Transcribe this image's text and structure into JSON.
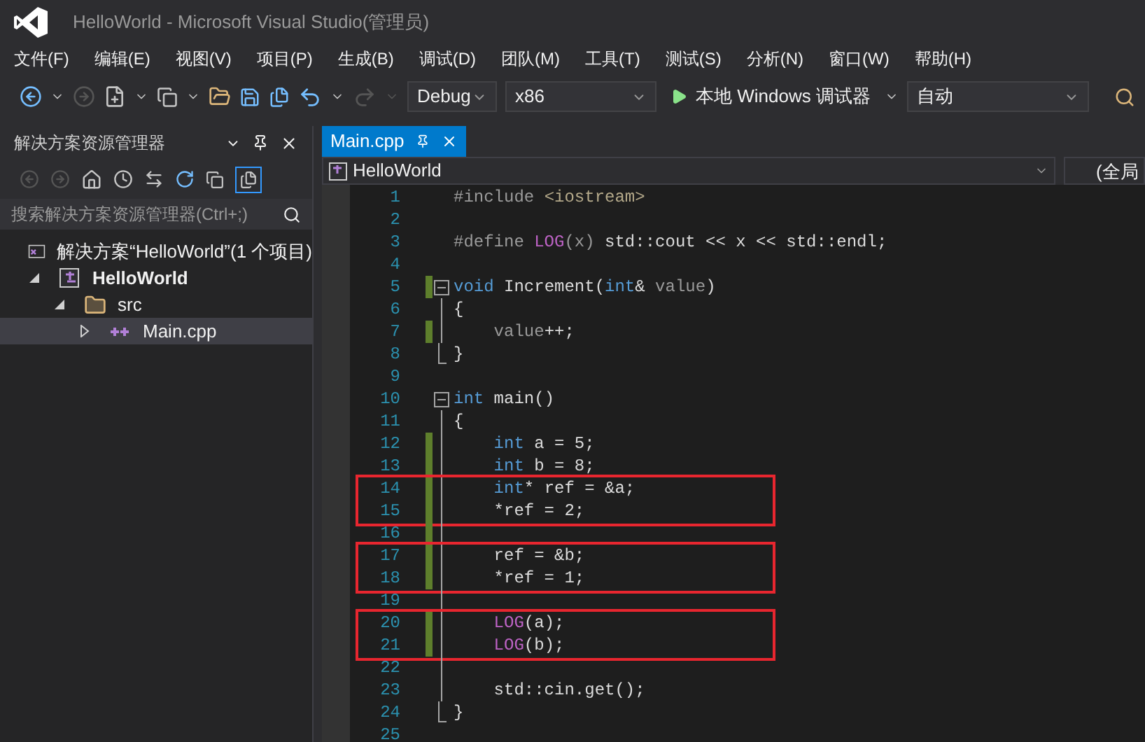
{
  "window": {
    "title": "HelloWorld - Microsoft Visual Studio(管理员)"
  },
  "menu": [
    "文件(F)",
    "编辑(E)",
    "视图(V)",
    "项目(P)",
    "生成(B)",
    "调试(D)",
    "团队(M)",
    "工具(T)",
    "测试(S)",
    "分析(N)",
    "窗口(W)",
    "帮助(H)"
  ],
  "toolbar": {
    "configuration": "Debug",
    "platform": "x86",
    "debugger": "本地 Windows 调试器",
    "target": "自动"
  },
  "solution_explorer": {
    "title": "解决方案资源管理器",
    "search": {
      "placeholder": "搜索解决方案资源管理器(Ctrl+;)"
    },
    "solution": {
      "label": "解决方案“HelloWorld”(1 个项目)"
    },
    "tree": [
      {
        "label": "HelloWorld",
        "kind": "project",
        "expanded": true,
        "selected": false,
        "children": [
          {
            "label": "src",
            "kind": "folder",
            "expanded": true,
            "selected": false,
            "children": [
              {
                "label": "Main.cpp",
                "kind": "file",
                "expanded": false,
                "selected": true
              }
            ]
          }
        ]
      }
    ]
  },
  "editor": {
    "tabs": [
      {
        "label": "Main.cpp",
        "selected": true
      }
    ],
    "navigation": {
      "scope": "HelloWorld",
      "member": "(全局"
    },
    "code_blocks": [
      {
        "boxed": false,
        "lines": [
          {
            "number": "1",
            "kind": "plain",
            "changed": false,
            "tokens": [
              {
                "kind": "preprocessor",
                "text": "#include "
              },
              {
                "kind": "string",
                "text": "<iostream>"
              }
            ]
          },
          {
            "number": "2",
            "kind": "plain",
            "changed": false
          },
          {
            "number": "3",
            "kind": "plain",
            "changed": false,
            "tokens": [
              {
                "kind": "preprocessor",
                "text": "#define "
              },
              {
                "kind": "macro",
                "text": "LOG"
              },
              {
                "kind": "param",
                "text": "(x)"
              },
              {
                "kind": "plain",
                "text": " std::cout << x << std::endl;"
              }
            ]
          },
          {
            "number": "4",
            "kind": "plain",
            "changed": false
          },
          {
            "number": "5",
            "kind": "foldstart",
            "changed": true,
            "tokens": [
              {
                "kind": "keyword",
                "text": "void"
              },
              {
                "kind": "plain",
                "text": " Increment("
              },
              {
                "kind": "keyword",
                "text": "int"
              },
              {
                "kind": "plain",
                "text": "& "
              },
              {
                "kind": "param",
                "text": "value"
              },
              {
                "kind": "plain",
                "text": ")"
              }
            ]
          },
          {
            "number": "6",
            "kind": "foldbody",
            "changed": false,
            "tokens": [
              {
                "kind": "plain",
                "text": "{"
              }
            ]
          },
          {
            "number": "7",
            "kind": "foldbody",
            "changed": true,
            "tokens": [
              {
                "kind": "param",
                "text": "    value"
              },
              {
                "kind": "plain",
                "text": "++;"
              }
            ]
          },
          {
            "number": "8",
            "kind": "foldend",
            "changed": false,
            "tokens": [
              {
                "kind": "plain",
                "text": "}"
              }
            ]
          },
          {
            "number": "9",
            "kind": "plain",
            "changed": false
          },
          {
            "number": "10",
            "kind": "foldstart",
            "changed": false,
            "tokens": [
              {
                "kind": "keyword",
                "text": "int"
              },
              {
                "kind": "plain",
                "text": " main()"
              }
            ]
          },
          {
            "number": "11",
            "kind": "foldbody",
            "changed": false,
            "tokens": [
              {
                "kind": "plain",
                "text": "{"
              }
            ]
          },
          {
            "number": "12",
            "kind": "foldbody",
            "changed": true,
            "tokens": [
              {
                "kind": "keyword",
                "text": "    int"
              },
              {
                "kind": "plain",
                "text": " a = 5;"
              }
            ]
          },
          {
            "number": "13",
            "kind": "foldbody",
            "changed": true,
            "tokens": [
              {
                "kind": "keyword",
                "text": "    int"
              },
              {
                "kind": "plain",
                "text": " b = 8;"
              }
            ]
          }
        ]
      },
      {
        "boxed": true,
        "lines": [
          {
            "number": "14",
            "kind": "foldbody",
            "changed": true,
            "tokens": [
              {
                "kind": "keyword",
                "text": "    int"
              },
              {
                "kind": "plain",
                "text": "* ref = &a;"
              }
            ]
          },
          {
            "number": "15",
            "kind": "foldbody",
            "changed": true,
            "tokens": [
              {
                "kind": "plain",
                "text": "    *ref = 2;"
              }
            ]
          }
        ]
      },
      {
        "boxed": false,
        "lines": [
          {
            "number": "16",
            "kind": "foldbody",
            "changed": true
          }
        ]
      },
      {
        "boxed": true,
        "lines": [
          {
            "number": "17",
            "kind": "foldbody",
            "changed": true,
            "tokens": [
              {
                "kind": "plain",
                "text": "    ref = &b;"
              }
            ]
          },
          {
            "number": "18",
            "kind": "foldbody",
            "changed": true,
            "tokens": [
              {
                "kind": "plain",
                "text": "    *ref = 1;"
              }
            ]
          }
        ]
      },
      {
        "boxed": false,
        "lines": [
          {
            "number": "19",
            "kind": "foldbody",
            "changed": false
          }
        ]
      },
      {
        "boxed": true,
        "lines": [
          {
            "number": "20",
            "kind": "foldbody",
            "changed": true,
            "tokens": [
              {
                "kind": "macro",
                "text": "    LOG"
              },
              {
                "kind": "plain",
                "text": "(a);"
              }
            ]
          },
          {
            "number": "21",
            "kind": "foldbody",
            "changed": true,
            "tokens": [
              {
                "kind": "macro",
                "text": "    LOG"
              },
              {
                "kind": "plain",
                "text": "(b);"
              }
            ]
          }
        ]
      },
      {
        "boxed": false,
        "lines": [
          {
            "number": "22",
            "kind": "foldbody",
            "changed": false
          },
          {
            "number": "23",
            "kind": "foldbody",
            "changed": false,
            "tokens": [
              {
                "kind": "plain",
                "text": "    std::cin.get();"
              }
            ]
          },
          {
            "number": "24",
            "kind": "foldend",
            "changed": false,
            "tokens": [
              {
                "kind": "plain",
                "text": "}"
              }
            ]
          },
          {
            "number": "25",
            "kind": "plain",
            "changed": false
          }
        ]
      }
    ]
  }
}
